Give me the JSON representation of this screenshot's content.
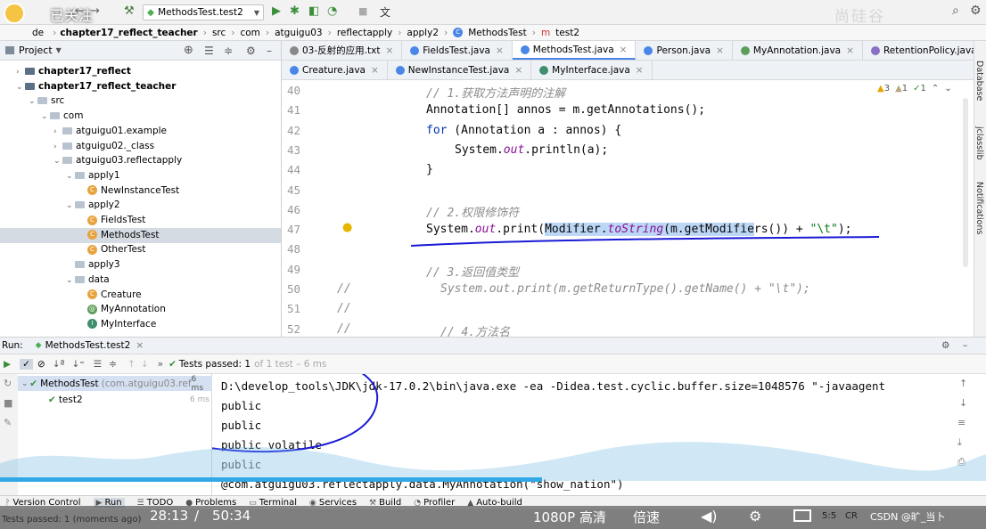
{
  "toolbar": {
    "overlay_badge": "已关注",
    "run_config": "MethodsTest.test2",
    "watermark": "尚硅谷"
  },
  "breadcrumbs": [
    "chapter17_reflect_teacher",
    "src",
    "com",
    "atguigu03",
    "reflectapply",
    "apply2",
    "MethodsTest",
    "test2"
  ],
  "breadcrumb_prefix": "de",
  "project_panel": {
    "title": "Project",
    "items": [
      {
        "label": "chapter17_reflect",
        "kind": "module",
        "indent": 1,
        "caret": "›",
        "bold": true
      },
      {
        "label": "chapter17_reflect_teacher",
        "kind": "module",
        "indent": 1,
        "caret": "⌄",
        "bold": true
      },
      {
        "label": "src",
        "kind": "folder",
        "indent": 2,
        "caret": "⌄"
      },
      {
        "label": "com",
        "kind": "folder",
        "indent": 3,
        "caret": "⌄"
      },
      {
        "label": "atguigu01.example",
        "kind": "folder",
        "indent": 4,
        "caret": "›"
      },
      {
        "label": "atguigu02._class",
        "kind": "folder",
        "indent": 4,
        "caret": "›"
      },
      {
        "label": "atguigu03.reflectapply",
        "kind": "folder",
        "indent": 4,
        "caret": "⌄"
      },
      {
        "label": "apply1",
        "kind": "folder",
        "indent": 5,
        "caret": "⌄"
      },
      {
        "label": "NewInstanceTest",
        "kind": "class",
        "indent": 6
      },
      {
        "label": "apply2",
        "kind": "folder",
        "indent": 5,
        "caret": "⌄"
      },
      {
        "label": "FieldsTest",
        "kind": "class",
        "indent": 6
      },
      {
        "label": "MethodsTest",
        "kind": "class",
        "indent": 6,
        "selected": true
      },
      {
        "label": "OtherTest",
        "kind": "class",
        "indent": 6
      },
      {
        "label": "apply3",
        "kind": "folder",
        "indent": 5
      },
      {
        "label": "data",
        "kind": "folder",
        "indent": 5,
        "caret": "⌄"
      },
      {
        "label": "Creature",
        "kind": "class",
        "indent": 6
      },
      {
        "label": "MyAnnotation",
        "kind": "annotation",
        "indent": 6
      },
      {
        "label": "MyInterface",
        "kind": "interface",
        "indent": 6
      }
    ]
  },
  "editor_tabs_row1": [
    {
      "label": "03-反射的应用.txt",
      "icon": "txt"
    },
    {
      "label": "FieldsTest.java",
      "icon": "class"
    },
    {
      "label": "MethodsTest.java",
      "icon": "class",
      "active": true
    },
    {
      "label": "Person.java",
      "icon": "class"
    },
    {
      "label": "MyAnnotation.java",
      "icon": "annotation"
    },
    {
      "label": "RetentionPolicy.java",
      "icon": "enum"
    }
  ],
  "editor_tabs_row2": [
    {
      "label": "Creature.java",
      "icon": "class"
    },
    {
      "label": "NewInstanceTest.java",
      "icon": "class"
    },
    {
      "label": "MyInterface.java",
      "icon": "interface"
    }
  ],
  "inspections": {
    "warnings": "3",
    "weak": "1",
    "typos": "1"
  },
  "code_lines": [
    {
      "num": "40",
      "indent": 0,
      "parts": [
        {
          "t": "// 1.获取方法声明的注解",
          "c": "cm"
        }
      ]
    },
    {
      "num": "41",
      "indent": 0,
      "parts": [
        {
          "t": "Annotation[] annos = m.getAnnotations();",
          "c": ""
        }
      ]
    },
    {
      "num": "42",
      "indent": 0,
      "parts": [
        {
          "t": "for",
          "c": "kw"
        },
        {
          "t": " (Annotation a : annos) {",
          "c": ""
        }
      ]
    },
    {
      "num": "43",
      "indent": 4,
      "parts": [
        {
          "t": "System.",
          "c": ""
        },
        {
          "t": "out",
          "c": "fld"
        },
        {
          "t": ".println(a);",
          "c": ""
        }
      ]
    },
    {
      "num": "44",
      "indent": 0,
      "parts": [
        {
          "t": "}",
          "c": ""
        }
      ]
    },
    {
      "num": "45",
      "indent": 0,
      "parts": []
    },
    {
      "num": "46",
      "indent": 0,
      "parts": [
        {
          "t": "// 2.权限修饰符",
          "c": "cm"
        }
      ]
    },
    {
      "num": "47",
      "indent": 0,
      "parts": [
        {
          "t": "System.",
          "c": ""
        },
        {
          "t": "out",
          "c": "fld"
        },
        {
          "t": ".print(",
          "c": ""
        },
        {
          "t": "Modifier.",
          "c": "hl"
        },
        {
          "t": "toString",
          "c": "hl fld"
        },
        {
          "t": "(m.getModifie",
          "c": "hl"
        },
        {
          "t": "rs()) + ",
          "c": ""
        },
        {
          "t": "\"\\t\"",
          "c": "st"
        },
        {
          "t": ");",
          "c": ""
        }
      ]
    },
    {
      "num": "48",
      "indent": 0,
      "parts": []
    },
    {
      "num": "49",
      "indent": 0,
      "parts": [
        {
          "t": "// 3.返回值类型",
          "c": "cm"
        }
      ]
    },
    {
      "num": "50",
      "indent": 2,
      "prefix": "//",
      "parts": [
        {
          "t": "System.out.print(m.getReturnType().getName() + \"\\t\");",
          "c": "cm"
        }
      ]
    },
    {
      "num": "51",
      "indent": 0,
      "prefix": "//",
      "parts": []
    },
    {
      "num": "52",
      "indent": 2,
      "prefix": "//",
      "parts": [
        {
          "t": "// 4.方法名",
          "c": "cm"
        }
      ]
    }
  ],
  "run_panel": {
    "label": "Run:",
    "config": "MethodsTest.test2",
    "tests_passed": "Tests passed: 1",
    "tests_passed_tail": "of 1 test – 6 ms",
    "tree": [
      {
        "label": "MethodsTest",
        "sub": "(com.atguigu03.ref",
        "time": "6 ms"
      },
      {
        "label": "test2",
        "time": "6 ms"
      }
    ]
  },
  "console_lines": [
    "D:\\develop_tools\\JDK\\jdk-17.0.2\\bin\\java.exe -ea -Didea.test.cyclic.buffer.size=1048576 \"-javaagent",
    "public",
    "public",
    "public volatile",
    "public",
    "@com.atguigu03.reflectapply.data.MyAnnotation(\"show_nation\")"
  ],
  "bottom_tools": [
    "Version Control",
    "Run",
    "TODO",
    "Problems",
    "Terminal",
    "Services",
    "Build",
    "Profiler",
    "Auto-build"
  ],
  "status": {
    "message": "Tests passed: 1 (moments ago)",
    "position": "5:5",
    "encoding": "CR",
    "credit": "CSDN @旷_当卜"
  },
  "video": {
    "time_current": "28:13",
    "time_total": "50:34",
    "quality": "1080P 高清",
    "speed": "倍速",
    "progress": 0.55
  },
  "right_strip": [
    "Database",
    "jclasslib",
    "Notifications"
  ]
}
